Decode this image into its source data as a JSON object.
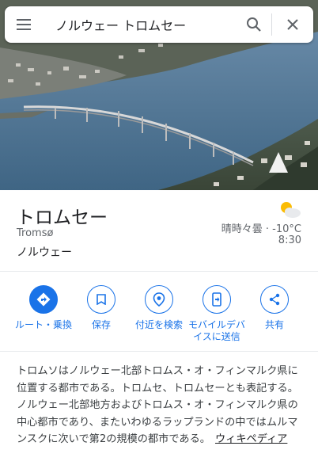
{
  "search": {
    "query": "ノルウェー トロムセー",
    "menu_icon": "menu-icon",
    "search_icon": "search-icon",
    "close_icon": "close-icon"
  },
  "place": {
    "name": "トロムセー",
    "native_name": "Tromsø",
    "country": "ノルウェー"
  },
  "weather": {
    "icon": "partly-cloudy-icon",
    "condition_temp": "晴時々曇 · -10°C",
    "time": "8:30"
  },
  "actions": [
    {
      "label": "ルート・乗換",
      "icon": "directions-icon"
    },
    {
      "label": "保存",
      "icon": "bookmark-icon"
    },
    {
      "label": "付近を検索",
      "icon": "nearby-icon"
    },
    {
      "label": "モバイルデバイスに送信",
      "icon": "send-to-phone-icon"
    },
    {
      "label": "共有",
      "icon": "share-icon"
    }
  ],
  "description": {
    "text": "トロムソはノルウェー北部トロムス・オ・フィンマルク県に位置する都市である。トロムセ、トロムセーとも表記する。ノルウェー北部地方およびトロムス・オ・フィンマルク県の中心都市であり、またいわゆるラップランドの中ではムルマンスクに次いで第2の規模の都市である。",
    "link": "ウィキペディア"
  },
  "colors": {
    "accent": "#1a73e8",
    "text_primary": "#202124",
    "text_secondary": "#5f6368"
  }
}
